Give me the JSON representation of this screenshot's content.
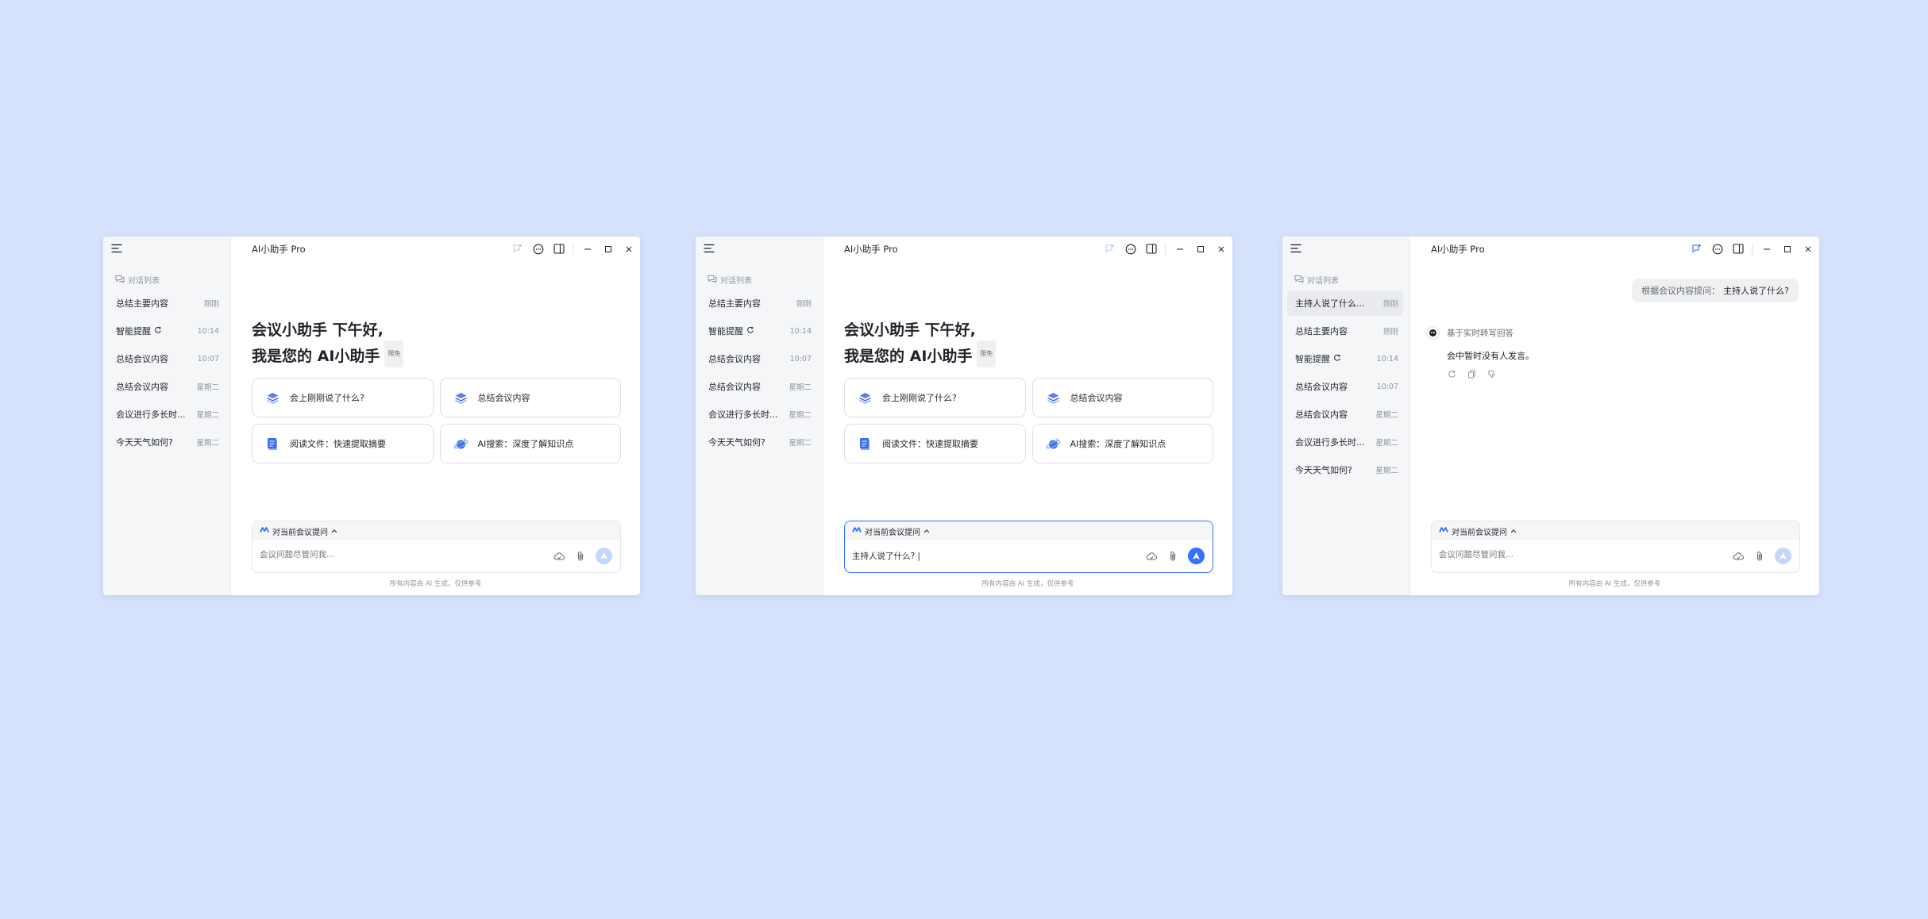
{
  "app_title": "AI小助手 Pro",
  "sidebar_header": "对话列表",
  "sidebar_items_home": [
    {
      "label": "总结主要内容",
      "time": "刚刚",
      "refresh": false
    },
    {
      "label": "智能提醒",
      "time": "10:14",
      "refresh": true
    },
    {
      "label": "总结会议内容",
      "time": "10:07",
      "refresh": false
    },
    {
      "label": "总结会议内容",
      "time": "星期二",
      "refresh": false
    },
    {
      "label": "会议进行多长时...",
      "time": "星期二",
      "refresh": false
    },
    {
      "label": "今天天气如何?",
      "time": "星期二",
      "refresh": false
    }
  ],
  "sidebar_items_chat": [
    {
      "label": "主持人说了什么...",
      "time": "刚刚",
      "refresh": false
    },
    {
      "label": "总结主要内容",
      "time": "刚刚",
      "refresh": false
    },
    {
      "label": "智能提醒",
      "time": "10:14",
      "refresh": true
    },
    {
      "label": "总结会议内容",
      "time": "10:07",
      "refresh": false
    },
    {
      "label": "总结会议内容",
      "time": "星期二",
      "refresh": false
    },
    {
      "label": "会议进行多长时...",
      "time": "星期二",
      "refresh": false
    },
    {
      "label": "今天天气如何?",
      "time": "星期二",
      "refresh": false
    }
  ],
  "greeting": {
    "line1": "会议小助手 下午好,",
    "line2": "我是您的 AI小助手",
    "badge": "限免"
  },
  "cards": [
    {
      "label": "会上刚刚说了什么?",
      "icon": "layers-icon"
    },
    {
      "label": "总结会议内容",
      "icon": "layers-icon"
    },
    {
      "label": "阅读文件：快速提取摘要",
      "icon": "document-icon"
    },
    {
      "label": "AI搜索：深度了解知识点",
      "icon": "planet-icon"
    }
  ],
  "composer": {
    "context_label": "对当前会议提问",
    "placeholder": "会议问题尽管问我...",
    "typed_text": "主持人说了什么? |"
  },
  "footer": "所有内容由 AI 生成，仅供参考",
  "chat": {
    "user_prefix": "根据会议内容提问：",
    "user_question": "主持人说了什么?",
    "bot_source": "基于实时转写回答",
    "bot_answer": "会中暂时没有人发言。"
  },
  "colors": {
    "background": "#d6e2fb",
    "accent": "#3370ff",
    "send_disabled": "#c5d6fb"
  }
}
